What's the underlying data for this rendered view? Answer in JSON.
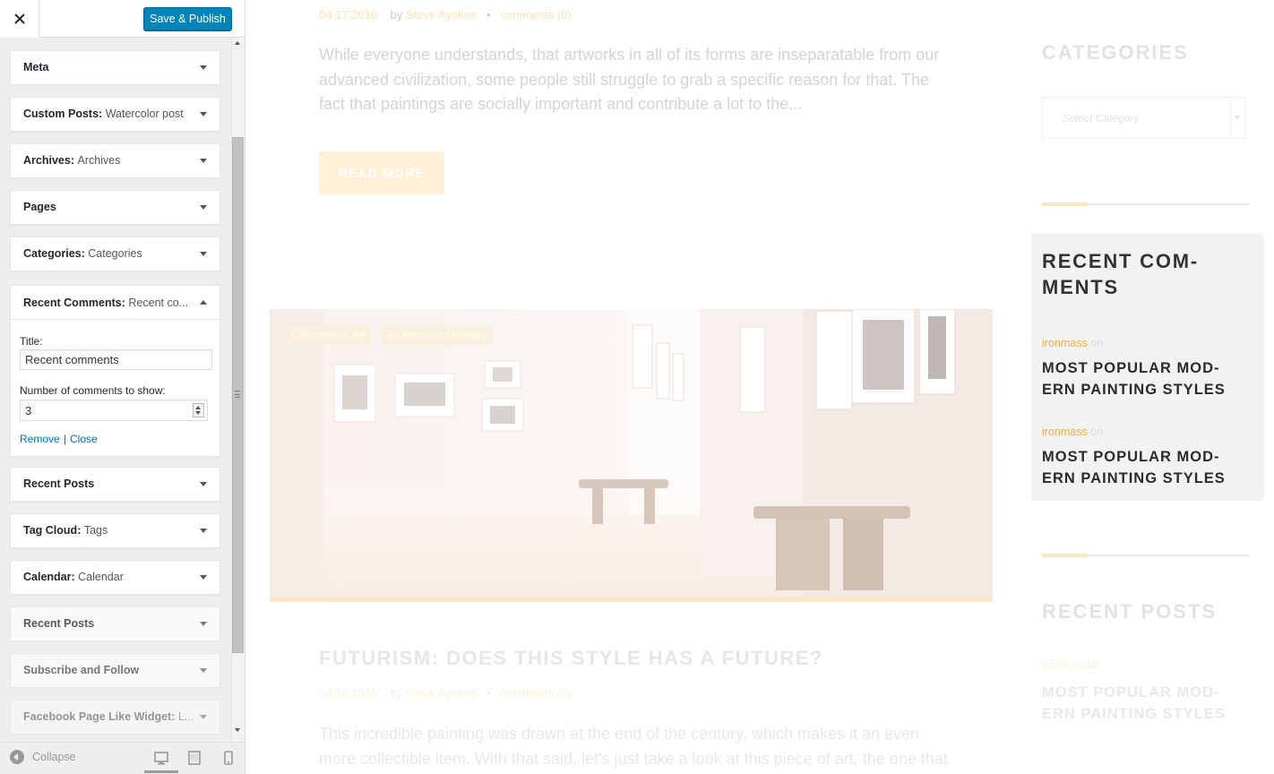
{
  "panel": {
    "publish_label": "Save & Publish",
    "widgets": [
      {
        "name": "Meta",
        "sub": ""
      },
      {
        "name": "Custom Posts",
        "sub": "Watercolor post"
      },
      {
        "name": "Archives",
        "sub": "Archives"
      },
      {
        "name": "Pages",
        "sub": ""
      },
      {
        "name": "Categories",
        "sub": "Categories"
      }
    ],
    "open_widget": {
      "name": "Recent Comments",
      "sub": "Recent co...",
      "title_label": "Title:",
      "title_value": "Recent comments",
      "count_label": "Number of comments to show:",
      "count_value": "3",
      "remove_label": "Remove",
      "separator": "|",
      "close_label": "Close"
    },
    "widgets_below": [
      {
        "name": "Recent Posts",
        "sub": ""
      },
      {
        "name": "Tag Cloud",
        "sub": "Tags"
      },
      {
        "name": "Calendar",
        "sub": "Calendar"
      },
      {
        "name": "Recent Posts",
        "sub": ""
      },
      {
        "name": "Subscribe and Follow",
        "sub": ""
      },
      {
        "name": "Facebook Page Like Widget",
        "sub": "L..."
      }
    ],
    "footer": {
      "collapse_label": "Collapse",
      "devices": [
        "desktop-icon",
        "tablet-icon",
        "mobile-icon"
      ]
    }
  },
  "preview": {
    "post1": {
      "date": "04.17.2016",
      "by": "by",
      "author": "Steve Ayokee",
      "bullet": "•",
      "comments": "comments (0)",
      "excerpt": "While everyone understands, that artworks in all of its forms are inseparatable from our advanced civilization, some people still struggle to grab a specific reason for that. The fact that paintings are socially important and contribute a lot to the...",
      "read_more": "READ MORE"
    },
    "post2": {
      "tags": [
        "Conceptual Art",
        "Expressive Drawing"
      ],
      "title": "FUTURISM: DOES THIS STYLE HAS A FUTURE?",
      "date": "04.16.2016",
      "by": "by",
      "author": "Steve Ayokee",
      "bullet": "•",
      "comments": "comments (0)",
      "excerpt": "This incredible painting was drawn at the end of the century, which makes it an even more collectible item. With that said, let's just take a look at this piece of art, the one that her"
    },
    "sidebar": {
      "categories_title": "CATEGORIES",
      "select_placeholder": "Select Category",
      "recent_comments_title": "RECENT COM-\nMENTS",
      "comments": [
        {
          "author": "ironmass",
          "on": "on",
          "post": "MOST POPULAR MOD-\nERN PAINTING STYLES"
        },
        {
          "author": "ironmass",
          "on": "on",
          "post": "MOST POPULAR MOD-\nERN PAINTING STYLES"
        }
      ],
      "recent_posts_title": "RECENT POSTS",
      "recent_post": {
        "date": "15.02.2016",
        "title": "MOST POPULAR MOD-\nERN PAINTING STYLES"
      }
    }
  },
  "colors": {
    "primary_button": "#0085ba",
    "link": "#0073aa",
    "accent": "#f0b040",
    "panel_bg": "#eeeeee"
  }
}
